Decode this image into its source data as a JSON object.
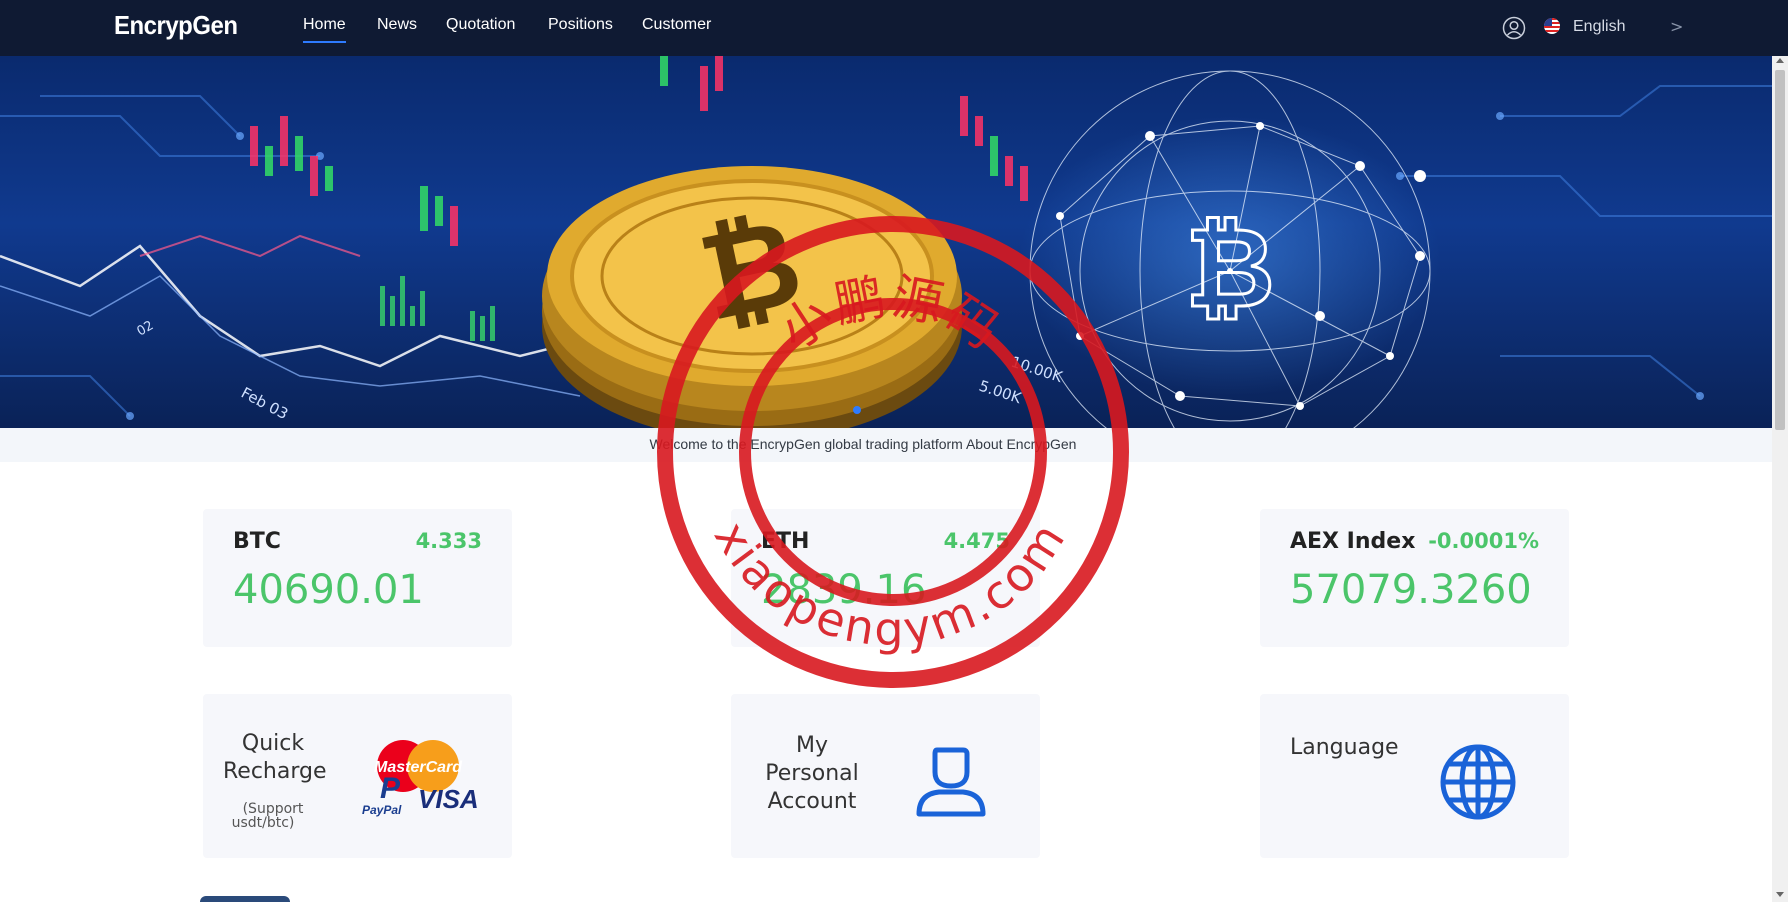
{
  "nav": {
    "logo": "EncrypGen",
    "links": [
      "Home",
      "News",
      "Quotation",
      "Positions",
      "Customer"
    ],
    "language": "English",
    "arrow": ">"
  },
  "banner": {
    "chart_labels": [
      "Feb 03",
      "10.00K",
      "5.00K",
      "02"
    ]
  },
  "welcome": "Welcome to the EncrypGen global trading platform About EncrypGen",
  "tickers": [
    {
      "name": "BTC",
      "change": "4.333",
      "price": "40690.01"
    },
    {
      "name": "ETH",
      "change": "4.475",
      "price": "2839.16"
    },
    {
      "name": "AEX Index",
      "change": "-0.0001%",
      "price": "57079.3260"
    }
  ],
  "features": {
    "recharge_title_1": "Quick",
    "recharge_title_2": "Recharge",
    "recharge_sub_1": "(Support",
    "recharge_sub_2": "usdt/btc)",
    "mastercard": "MasterCard",
    "paypal": "PayPal",
    "visa": "VISA",
    "account_1": "My",
    "account_2": "Personal",
    "account_3": "Account",
    "language": "Language"
  },
  "watermark": {
    "top": "小鹏源码",
    "bottom": "xiaopengym.com"
  },
  "colors": {
    "nav_bg": "#0f1a33",
    "accent": "#2e7bff",
    "up_green": "#4bc56a",
    "stamp_red": "#d8181f",
    "icon_blue": "#1a63d8"
  },
  "icons": [
    "user-icon",
    "us-flag-icon",
    "chevron-right-icon",
    "person-icon",
    "globe-icon"
  ]
}
